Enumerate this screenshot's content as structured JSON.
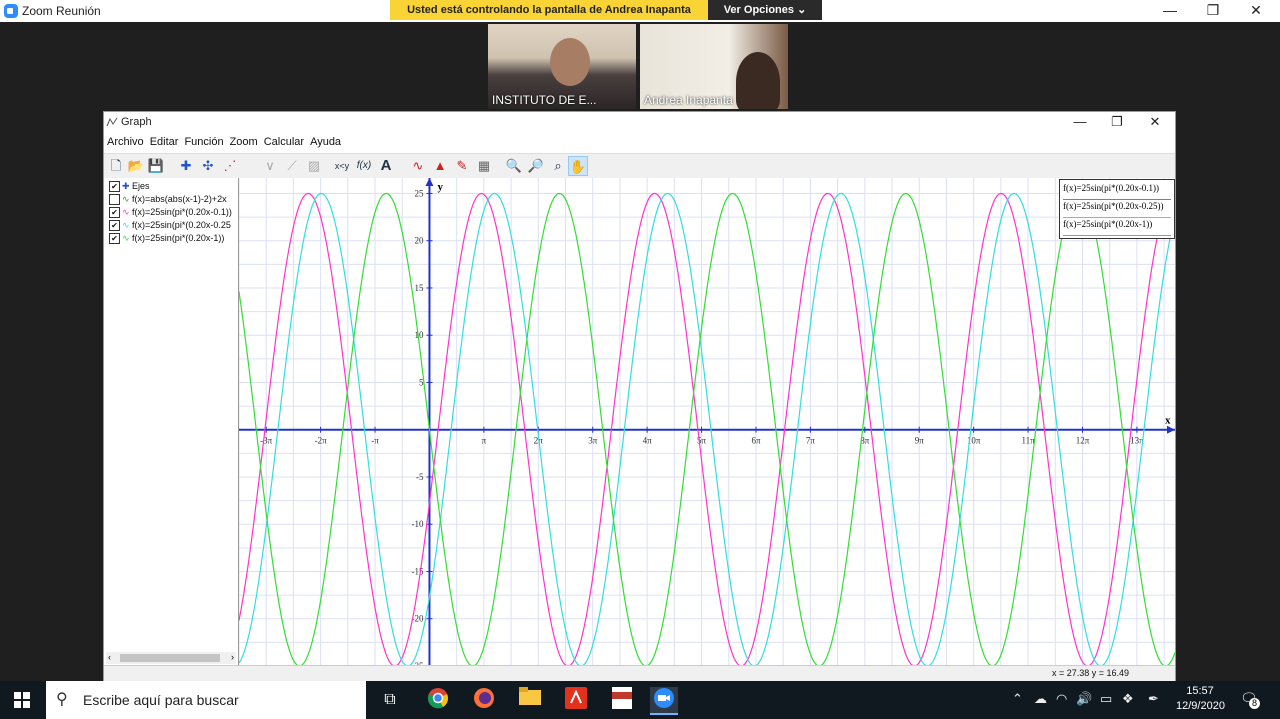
{
  "zoom": {
    "title": "Zoom Reunión",
    "banner": "Usted está controlando la pantalla de Andrea Inapanta",
    "view_options": "Ver Opciones",
    "participants": [
      "INSTITUTO DE E...",
      "Andrea Inapanta"
    ]
  },
  "graph_window": {
    "title": "Graph",
    "menu": [
      "Archivo",
      "Editar",
      "Función",
      "Zoom",
      "Calcular",
      "Ayuda"
    ],
    "functions": [
      {
        "label": "Ejes",
        "checked": true
      },
      {
        "label": "f(x)=abs(abs(x-1)-2)+2x",
        "checked": false
      },
      {
        "label": "f(x)=25sin(pi*(0.20x-0.1))",
        "checked": true
      },
      {
        "label": "f(x)=25sin(pi*(0.20x-0.25",
        "checked": true
      },
      {
        "label": "f(x)=25sin(pi*(0.20x-1))",
        "checked": true
      }
    ],
    "legend": [
      "f(x)=25sin(pi*(0.20x-0.1))",
      "f(x)=25sin(pi*(0.20x-0.25))",
      "f(x)=25sin(pi*(0.20x-1))"
    ],
    "status": "x = 27.38    y = 16.49"
  },
  "chart_data": {
    "type": "line",
    "xlabel": "x",
    "ylabel": "y",
    "xlim": [
      -3.5,
      13.7
    ],
    "ylim": [
      -25,
      26
    ],
    "x_ticks": [
      "-3π",
      "-2π",
      "-π",
      "π",
      "2π",
      "3π",
      "4π",
      "5π",
      "6π",
      "7π",
      "8π",
      "9π",
      "10π",
      "11π",
      "12π",
      "13π"
    ],
    "y_ticks": [
      25,
      20,
      15,
      10,
      5,
      -5,
      -10,
      -15,
      -20,
      -25
    ],
    "x_unit": "π",
    "series": [
      {
        "name": "f(x)=25sin(pi*(0.20x-0.1))",
        "amplitude": 25,
        "k": 0.2,
        "phase": 0.1,
        "color": "#ff33cc"
      },
      {
        "name": "f(x)=25sin(pi*(0.20x-0.25))",
        "amplitude": 25,
        "k": 0.2,
        "phase": 0.25,
        "color": "#33dddd"
      },
      {
        "name": "f(x)=25sin(pi*(0.20x-1))",
        "amplitude": 25,
        "k": 0.2,
        "phase": 1,
        "color": "#33dd33"
      }
    ],
    "grid": true
  },
  "taskbar": {
    "search_placeholder": "Escribe aquí para buscar",
    "time": "15:57",
    "date": "12/9/2020",
    "notifications": "8",
    "apps": [
      "task-view",
      "chrome",
      "firefox",
      "file-explorer",
      "acrobat",
      "pdf-editor",
      "zoom"
    ]
  }
}
